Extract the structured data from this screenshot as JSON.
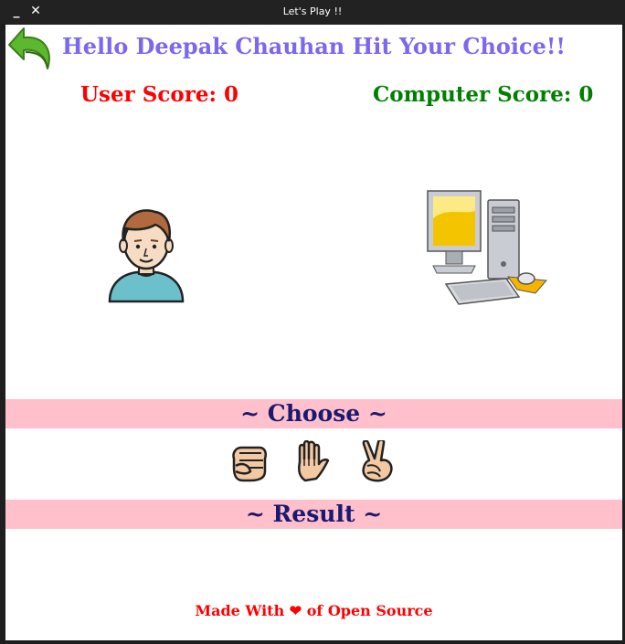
{
  "window": {
    "title": "Let's Play !!",
    "minimize_label": "_",
    "close_label": "✕"
  },
  "greeting": "Hello Deepak Chauhan Hit Your Choice!!",
  "scores": {
    "user": "User Score: 0",
    "computer": "Computer Score: 0"
  },
  "choose_banner": "~ Choose ~",
  "result_banner": "~ Result ~",
  "footer": {
    "before": "Made With ",
    "heart": "❤",
    "after": " of Open Source"
  },
  "choices": [
    "rock",
    "paper",
    "scissors"
  ],
  "colors": {
    "greeting": "#7b68ee",
    "user_score": "#ff0000",
    "computer_score": "#008000",
    "banner_bg": "#ffc0cb",
    "banner_text": "#191970",
    "footer": "#ff0000"
  }
}
